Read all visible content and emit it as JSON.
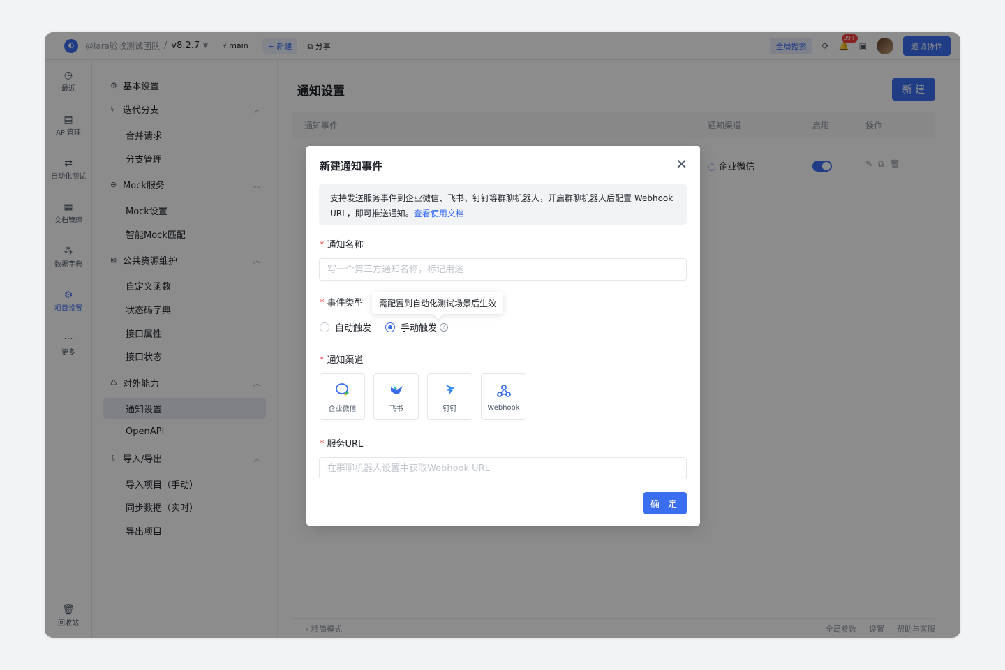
{
  "topbar": {
    "team": "@lara验收测试团队",
    "separator": "/",
    "version": "v8.2.7",
    "branch": "main",
    "new_label": "+ 新建",
    "share_label": "分享",
    "global_search": "全局搜索",
    "notification_badge": "99+",
    "invite_label": "邀请协作"
  },
  "rail": [
    {
      "label": "最近",
      "icon": "history-icon",
      "glyph": "◷"
    },
    {
      "label": "API管理",
      "icon": "api-icon",
      "glyph": "▤"
    },
    {
      "label": "自动化测试",
      "icon": "automation-icon",
      "glyph": "⇄"
    },
    {
      "label": "文档管理",
      "icon": "document-icon",
      "glyph": "▦"
    },
    {
      "label": "数据字典",
      "icon": "data-dictionary-icon",
      "glyph": "⁂"
    },
    {
      "label": "项目设置",
      "icon": "project-settings-icon",
      "glyph": "⚙"
    },
    {
      "label": "更多",
      "icon": "more-icon",
      "glyph": "···"
    },
    {
      "label": "回收站",
      "icon": "trash-icon",
      "glyph": "🗑"
    }
  ],
  "menu": {
    "basic_settings": "基本设置",
    "iteration_branch": "迭代分支",
    "merge_request": "合并请求",
    "branch_management": "分支管理",
    "mock_service": "Mock服务",
    "mock_settings": "Mock设置",
    "smart_mock": "智能Mock匹配",
    "public_resources": "公共资源维护",
    "custom_functions": "自定义函数",
    "status_codes": "状态码字典",
    "api_attributes": "接口属性",
    "api_status": "接口状态",
    "external_capabilities": "对外能力",
    "notification_settings": "通知设置",
    "openapi": "OpenAPI",
    "import_export": "导入/导出",
    "import_manual": "导入项目（手动）",
    "sync_realtime": "同步数据（实时）",
    "export_project": "导出项目"
  },
  "main": {
    "title": "通知设置",
    "new_button": "新 建",
    "columns": [
      "通知事件",
      "通知渠道",
      "启用",
      "操作"
    ],
    "row": {
      "channel": "企业微信",
      "enabled": true
    },
    "footer_left": "精简模式",
    "footer_right": [
      "全局参数",
      "设置",
      "帮助与客服"
    ]
  },
  "modal": {
    "title": "新建通知事件",
    "tip_text": "支持发送服务事件到企业微信、飞书、钉钉等群聊机器人，开启群聊机器人后配置 Webhook URL，即可推送通知。",
    "tip_link": "查看使用文档",
    "name_label": "通知名称",
    "name_placeholder": "写一个第三方通知名称，标记用途",
    "event_type_label": "事件类型",
    "event_options": [
      "自动触发",
      "手动触发"
    ],
    "selected_event": "手动触发",
    "tooltip": "需配置到自动化测试场景后生效",
    "channel_label": "通知渠道",
    "channels": [
      {
        "label": "企业微信",
        "icon": "wecom-icon"
      },
      {
        "label": "飞书",
        "icon": "feishu-icon"
      },
      {
        "label": "钉钉",
        "icon": "dingtalk-icon"
      },
      {
        "label": "Webhook",
        "icon": "webhook-icon"
      }
    ],
    "url_label": "服务URL",
    "url_placeholder": "在群聊机器人设置中获取Webhook URL",
    "confirm_button": "确 定"
  },
  "colors": {
    "accent": "#3a6df0",
    "required": "#f53f3f",
    "overlay": "rgba(0,0,0,0.45)"
  }
}
